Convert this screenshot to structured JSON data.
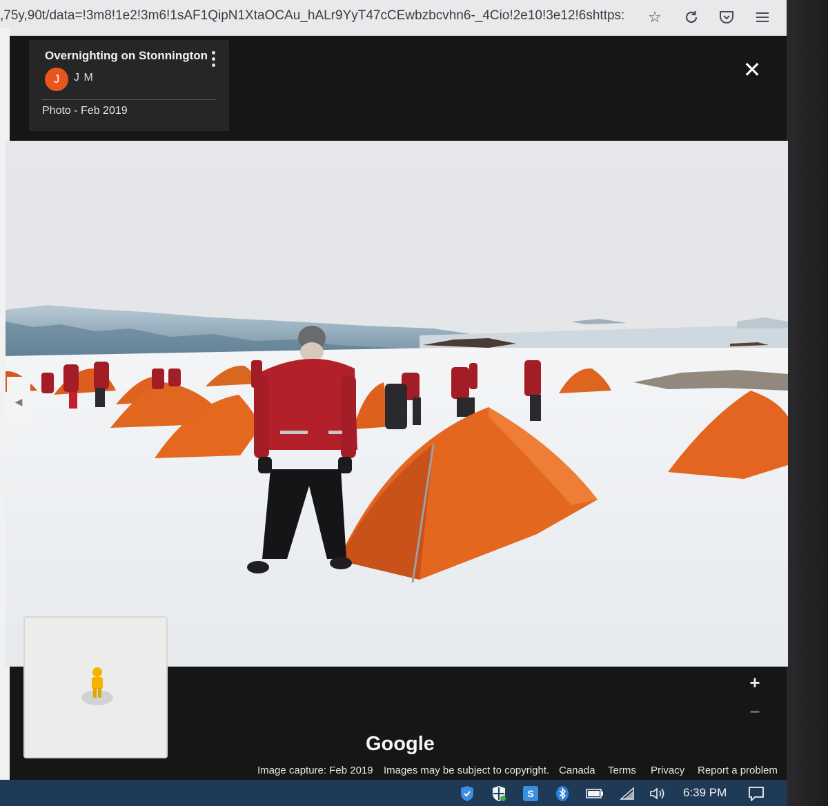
{
  "browser": {
    "url": ",75y,90t/data=!3m8!1e2!3m6!1sAF1QipN1XtaOCAu_hALr9YyT47cCEwbzbcvhn6-_4Cio!2e10!3e12!6shttps:",
    "icons": [
      "star-icon",
      "reload-icon",
      "pocket-icon",
      "menu-icon"
    ]
  },
  "viewer": {
    "title": "Overnighting on Stonnington",
    "author_initial": "J",
    "author_name": "J M",
    "photo_date": "Photo - Feb 2019",
    "close_label": "✕",
    "zoom_in": "+",
    "zoom_out": "−",
    "brand": "Google",
    "footer": {
      "capture": "Image capture: Feb 2019",
      "copyright": "Images may be subject to copyright.",
      "country": "Canada",
      "terms": "Terms",
      "privacy": "Privacy",
      "report": "Report a problem"
    }
  },
  "taskbar": {
    "time": "6:39 PM",
    "icons": [
      "defender-icon",
      "security-shield-icon",
      "s-app-icon",
      "bluetooth-icon",
      "battery-icon",
      "wifi-icon",
      "volume-icon",
      "notification-icon"
    ]
  },
  "colors": {
    "avatar": "#e8551f",
    "tent": "#e2621f",
    "jacket": "#b3202a",
    "taskbar": "#1f3a57"
  }
}
